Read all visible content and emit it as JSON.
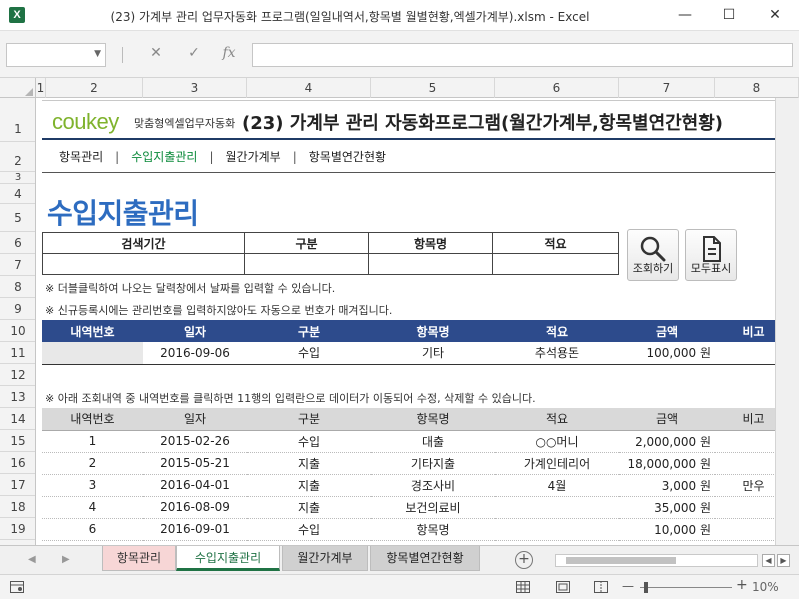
{
  "window": {
    "app_icon": "X",
    "title": "(23) 가계부 관리 업무자동화 프로그램(일일내역서,항목별 월별현황,엑셀가계부).xlsm - Excel",
    "minimize": "—",
    "maximize": "☐",
    "close": "✕"
  },
  "formula_bar": {
    "cancel": "✕",
    "enter": "✓",
    "fx": "fx"
  },
  "columns": [
    "1",
    "2",
    "3",
    "4",
    "5",
    "6",
    "7",
    "8"
  ],
  "rows": [
    "1",
    "2",
    "3",
    "4",
    "5",
    "6",
    "7",
    "8",
    "9",
    "10",
    "11",
    "12",
    "13",
    "14",
    "15",
    "16",
    "17",
    "18",
    "19"
  ],
  "banner": {
    "logo_cou": "cou",
    "logo_key": "key",
    "logo_sub": "맞춤형엑셀업무자동화",
    "title": "(23) 가계부 관리 자동화프로그램(월간가계부,항목별연간현황)"
  },
  "nav": {
    "items": [
      "항목관리",
      "수입지출관리",
      "월간가계부",
      "항목별연간현황"
    ],
    "separator": "|"
  },
  "page_title": "수입지출관리",
  "search": {
    "header_period": "검색기간",
    "header_type": "구분",
    "header_item": "항목명",
    "header_memo": "적요"
  },
  "buttons": {
    "search": "조회하기",
    "show_all": "모두표시"
  },
  "notes": {
    "n8": "※ 더블클릭하여 나오는 달력창에서 날짜를 입력할 수 있습니다.",
    "n9": "※ 신규등록시에는 관리번호를 입력하지않아도 자동으로 번호가 매겨집니다.",
    "n13": "※ 아래 조회내역 중 내역번호를 클릭하면 11행의 입력란으로 데이터가 이동되어 수정, 삭제할 수 있습니다."
  },
  "entry_table": {
    "headers": [
      "내역번호",
      "일자",
      "구분",
      "항목명",
      "적요",
      "금액",
      "비고"
    ],
    "row": [
      "",
      "2016-09-06",
      "수입",
      "기타",
      "추석용돈",
      "100,000 원",
      ""
    ]
  },
  "list_table": {
    "headers": [
      "내역번호",
      "일자",
      "구분",
      "항목명",
      "적요",
      "금액",
      "비고"
    ],
    "rows": [
      [
        "1",
        "2015-02-26",
        "수입",
        "대출",
        "○○머니",
        "2,000,000 원",
        ""
      ],
      [
        "2",
        "2015-05-21",
        "지출",
        "기타지출",
        "가계인테리어",
        "18,000,000 원",
        ""
      ],
      [
        "3",
        "2016-04-01",
        "지출",
        "경조사비",
        "4월",
        "3,000 원",
        "만우"
      ],
      [
        "4",
        "2016-08-09",
        "지출",
        "보건의료비",
        "",
        "35,000 원",
        ""
      ],
      [
        "6",
        "2016-09-01",
        "수입",
        "항목명",
        "",
        "10,000 원",
        ""
      ]
    ]
  },
  "sheet_tabs": [
    "항목관리",
    "수입지출관리",
    "월간가계부",
    "항목별연간현황"
  ],
  "tab_nav": {
    "prev": "◀",
    "next": "▶",
    "add": "+"
  },
  "status": {
    "zoom": "10%",
    "minus": "—",
    "plus": "+"
  }
}
